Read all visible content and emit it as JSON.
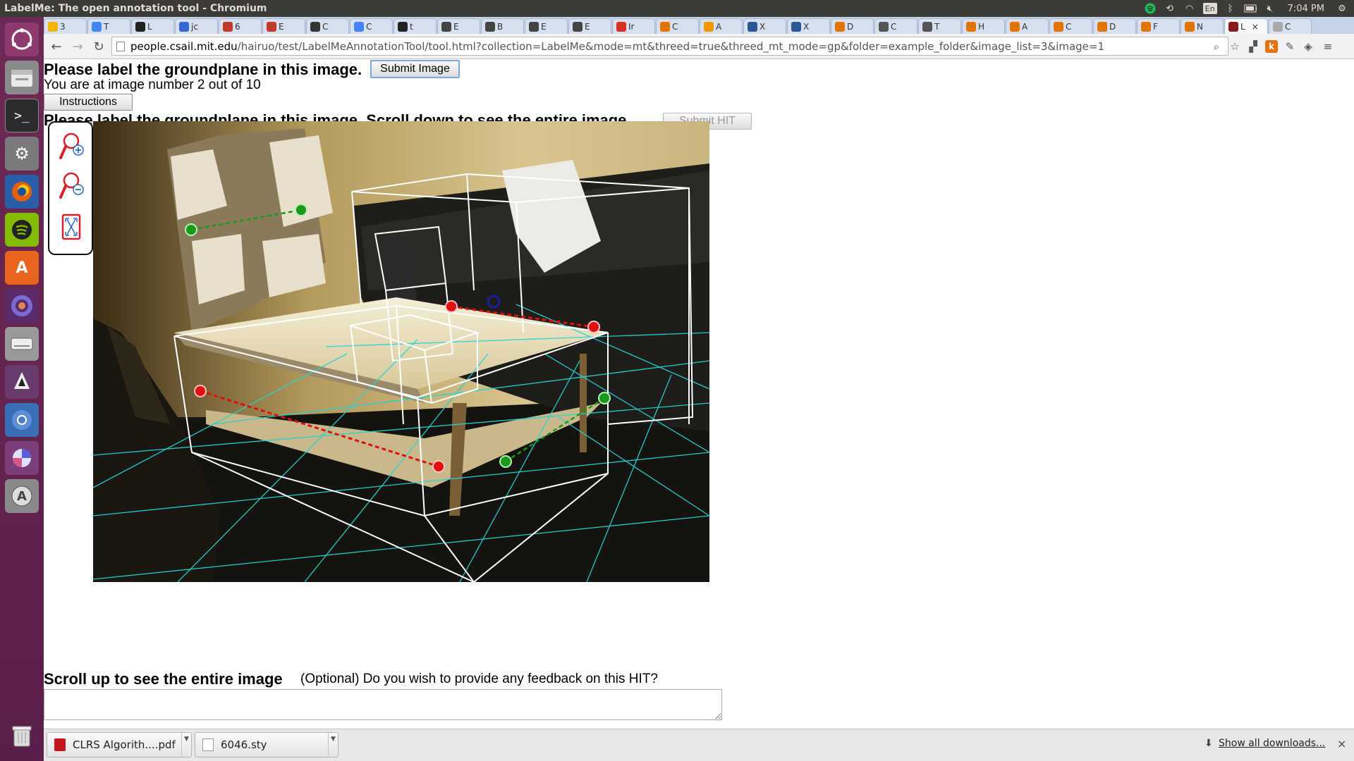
{
  "window": {
    "title": "LabelMe: The open annotation tool - Chromium",
    "tray": {
      "keyboard": "En",
      "clock": "7:04 PM"
    }
  },
  "tabs": [
    {
      "label": "3",
      "color": "#f4b400"
    },
    {
      "label": "T",
      "color": "#4285f4"
    },
    {
      "label": "L",
      "color": "#222222"
    },
    {
      "label": "jc",
      "color": "#3367d6"
    },
    {
      "label": "6",
      "color": "#c0392b"
    },
    {
      "label": "E",
      "color": "#c0392b"
    },
    {
      "label": "C",
      "color": "#333333"
    },
    {
      "label": "C",
      "color": "#4285f4"
    },
    {
      "label": "t",
      "color": "#222222"
    },
    {
      "label": "E",
      "color": "#444444"
    },
    {
      "label": "B",
      "color": "#444444"
    },
    {
      "label": "E",
      "color": "#444444"
    },
    {
      "label": "E",
      "color": "#444444"
    },
    {
      "label": "Ir",
      "color": "#d93025"
    },
    {
      "label": "C",
      "color": "#e37400"
    },
    {
      "label": "A",
      "color": "#f29900"
    },
    {
      "label": "X",
      "color": "#2b5797"
    },
    {
      "label": "X",
      "color": "#2b5797"
    },
    {
      "label": "D",
      "color": "#e37400"
    },
    {
      "label": "C",
      "color": "#555555"
    },
    {
      "label": "T",
      "color": "#555555"
    },
    {
      "label": "H",
      "color": "#e37400"
    },
    {
      "label": "A",
      "color": "#e37400"
    },
    {
      "label": "C",
      "color": "#e37400"
    },
    {
      "label": "D",
      "color": "#e37400"
    },
    {
      "label": "F",
      "color": "#e37400"
    },
    {
      "label": "N",
      "color": "#e37400"
    },
    {
      "label": "L",
      "color": "#8b1a1a",
      "active": true
    },
    {
      "label": "C",
      "color": "#aaaaaa"
    }
  ],
  "address": {
    "host": "people.csail.mit.edu",
    "path": "/hairuo/test/LabelMeAnnotationTool/tool.html?collection=LabelMe&mode=mt&threed=true&threed_mt_mode=gp&folder=example_folder&image_list=3&image=1"
  },
  "page": {
    "heading": "Please label the groundplane in this image.",
    "submit_image": "Submit Image",
    "progress": "You are at image number 2 out of 10",
    "instructions": "Instructions",
    "heading2": "Please label the groundplane in this image. Scroll down to see the entire image.",
    "submit_hit": "Submit HIT",
    "scroll_up": "Scroll up to see the entire image",
    "feedback_prompt": "(Optional) Do you wish to provide any feedback on this HIT?"
  },
  "tools": [
    {
      "name": "zoom-in-icon"
    },
    {
      "name": "zoom-out-icon"
    },
    {
      "name": "fit-to-screen-icon"
    }
  ],
  "downloads": {
    "items": [
      "CLRS Algorith....pdf",
      "6046.sty"
    ],
    "show_all": "Show all downloads..."
  },
  "colors": {
    "grid": "#22d3d3",
    "point_red": "#e01010",
    "point_green": "#1a9a1a",
    "point_blue": "#1020d0"
  }
}
